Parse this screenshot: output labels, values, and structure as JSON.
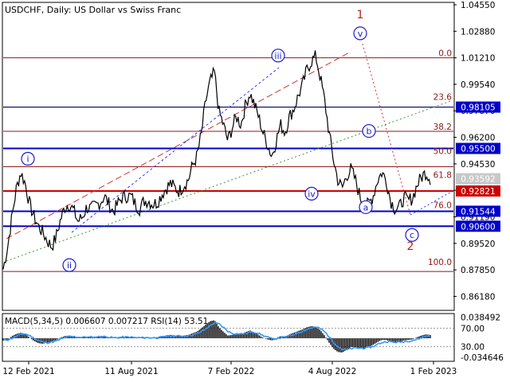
{
  "header": {
    "title": "USDCHF, Daily:  US Dollar vs Swiss Franc"
  },
  "colors": {
    "background": "#ffffff",
    "price": "#000000",
    "fib_line": "#8b1a1a",
    "support_line": "#0000cc",
    "red_line": "#cc0000",
    "wave_blue": "#1a1acc",
    "wave_red": "#b22222",
    "trend_red": "#cc3333",
    "trend_blue": "#3333ff",
    "trend_green": "#339933",
    "macd_hist": "#000000",
    "macd_signal": "#3399ff",
    "grid_dot": "#999999",
    "tag_blue": "#0000cc",
    "tag_red": "#cc0000",
    "tag_gray": "#c8c8c8"
  },
  "chart_data": [
    {
      "type": "line",
      "title": "USDCHF, Daily:  US Dollar vs Swiss Franc",
      "x_ticks": [
        "12 Feb 2021",
        "11 Aug 2021",
        "7 Feb 2022",
        "4 Aug 2022",
        "1 Feb 2023"
      ],
      "y_ticks": [
        "1.04550",
        "1.02880",
        "1.01210",
        "0.99540",
        "0.97870",
        "0.96200",
        "0.94530",
        "0.92860",
        "0.91190",
        "0.89520",
        "0.87850",
        "0.86180"
      ],
      "ylim": [
        0.8535,
        1.0465
      ],
      "series": [
        {
          "values": [
            0.879,
            0.893,
            0.912,
            0.93,
            0.94,
            0.933,
            0.92,
            0.912,
            0.906,
            0.902,
            0.897,
            0.893,
            0.899,
            0.91,
            0.918,
            0.92,
            0.916,
            0.909,
            0.912,
            0.918,
            0.917,
            0.919,
            0.921,
            0.925,
            0.92,
            0.915,
            0.92,
            0.924,
            0.925,
            0.925,
            0.92,
            0.917,
            0.922,
            0.922,
            0.92,
            0.921,
            0.926,
            0.93,
            0.933,
            0.93,
            0.928,
            0.932,
            0.935,
            0.944,
            0.95,
            0.964,
            0.985,
            0.997,
            1.003,
            0.978,
            0.97,
            0.96,
            0.968,
            0.975,
            0.97,
            0.982,
            0.99,
            0.983,
            0.975,
            0.965,
            0.958,
            0.95,
            0.96,
            0.97,
            0.965,
            0.975,
            0.98,
            0.988,
            0.995,
            1.005,
            1.01,
            1.013,
            1.0,
            0.985,
            0.965,
            0.948,
            0.935,
            0.93,
            0.938,
            0.942,
            0.935,
            0.925,
            0.918,
            0.92,
            0.925,
            0.935,
            0.94,
            0.935,
            0.922,
            0.917,
            0.918,
            0.924,
            0.922,
            0.924,
            0.932,
            0.937,
            0.94,
            0.936
          ]
        }
      ],
      "price_tags": [
        {
          "label": "0.98105",
          "value": 0.98105,
          "style": "blue"
        },
        {
          "label": "0.95500",
          "value": 0.955,
          "style": "blue"
        },
        {
          "label": "0.93592",
          "value": 0.93592,
          "style": "gray"
        },
        {
          "label": "0.92821",
          "value": 0.92821,
          "style": "red"
        },
        {
          "label": "0.91544",
          "value": 0.91544,
          "style": "blue"
        },
        {
          "label": "0.90600",
          "value": 0.906,
          "style": "blue"
        }
      ],
      "horizontal_lines": [
        {
          "value": 1.0121,
          "style": "fib"
        },
        {
          "value": 0.98105,
          "style": "blue_thin"
        },
        {
          "value": 0.9658,
          "style": "fib"
        },
        {
          "value": 0.955,
          "style": "blue"
        },
        {
          "value": 0.9435,
          "style": "fib"
        },
        {
          "value": 0.92821,
          "style": "red"
        },
        {
          "value": 0.91544,
          "style": "blue"
        },
        {
          "value": 0.906,
          "style": "blue"
        },
        {
          "value": 0.8775,
          "style": "fib"
        }
      ],
      "fib_labels": [
        {
          "label": "0.0",
          "value": 1.0121
        },
        {
          "label": "23.6",
          "value": 0.9845
        },
        {
          "label": "38.2",
          "value": 0.9658
        },
        {
          "label": "50.0",
          "value": 0.9505
        },
        {
          "label": "61.8",
          "value": 0.9355
        },
        {
          "label": "76.0",
          "value": 0.9165
        },
        {
          "label": "100.0",
          "value": 0.8805
        }
      ],
      "wave_labels": [
        {
          "label": "i",
          "value": 0.9485,
          "style": "blue_circle"
        },
        {
          "label": "ii",
          "value": 0.8815,
          "style": "blue_circle"
        },
        {
          "label": "iii",
          "value": 1.0135,
          "style": "blue_circle"
        },
        {
          "label": "iv",
          "value": 0.9265,
          "style": "blue_circle"
        },
        {
          "label": "v",
          "value": 1.0275,
          "style": "blue_circle"
        },
        {
          "label": "1",
          "value": 1.0395,
          "style": "red_text"
        },
        {
          "label": "a",
          "value": 0.918,
          "style": "blue_circle"
        },
        {
          "label": "b",
          "value": 0.966,
          "style": "blue_circle"
        },
        {
          "label": "c",
          "value": 0.9005,
          "style": "blue_circle"
        },
        {
          "label": "2",
          "value": 0.8935,
          "style": "red_text"
        }
      ]
    },
    {
      "type": "area",
      "title": "MACD(5,34,5) 0.006607 0.007217 RSI(14) 53.51",
      "y_ticks": [
        "0.038492",
        "70.00",
        "30.00",
        "-0.034646"
      ],
      "ylim": [
        -0.0405,
        0.0435
      ],
      "rsi_levels": [
        70,
        30
      ],
      "macd": [
        -0.004,
        -0.003,
        0.004,
        0.008,
        0.01,
        0.008,
        0.001,
        -0.005,
        -0.009,
        -0.01,
        -0.008,
        -0.006,
        -0.003,
        0.001,
        0.004,
        0.005,
        0.003,
        0.001,
        0.002,
        0.003,
        0.002,
        0.003,
        0.004,
        0.004,
        0.002,
        0.0,
        0.002,
        0.003,
        0.003,
        0.002,
        0.001,
        0.0,
        0.002,
        0.002,
        0.001,
        0.002,
        0.003,
        0.005,
        0.006,
        0.005,
        0.004,
        0.005,
        0.006,
        0.009,
        0.012,
        0.018,
        0.025,
        0.031,
        0.033,
        0.02,
        0.012,
        0.005,
        0.006,
        0.009,
        0.007,
        0.011,
        0.014,
        0.011,
        0.006,
        0.001,
        -0.002,
        -0.004,
        0.0,
        0.004,
        0.003,
        0.007,
        0.01,
        0.013,
        0.016,
        0.02,
        0.022,
        0.021,
        0.015,
        0.005,
        -0.008,
        -0.019,
        -0.025,
        -0.026,
        -0.021,
        -0.016,
        -0.016,
        -0.018,
        -0.019,
        -0.016,
        -0.012,
        -0.007,
        -0.003,
        -0.003,
        -0.007,
        -0.009,
        -0.007,
        -0.004,
        -0.003,
        -0.002,
        0.002,
        0.005,
        0.007,
        0.006
      ],
      "signal": [
        -0.002,
        -0.003,
        0.0,
        0.004,
        0.007,
        0.008,
        0.005,
        0.0,
        -0.004,
        -0.007,
        -0.008,
        -0.007,
        -0.005,
        -0.002,
        0.001,
        0.003,
        0.003,
        0.002,
        0.002,
        0.002,
        0.002,
        0.002,
        0.003,
        0.003,
        0.002,
        0.001,
        0.001,
        0.002,
        0.002,
        0.002,
        0.001,
        0.001,
        0.001,
        0.001,
        0.001,
        0.001,
        0.002,
        0.003,
        0.004,
        0.004,
        0.004,
        0.004,
        0.005,
        0.006,
        0.008,
        0.012,
        0.017,
        0.023,
        0.028,
        0.026,
        0.02,
        0.013,
        0.009,
        0.008,
        0.008,
        0.009,
        0.011,
        0.011,
        0.009,
        0.005,
        0.002,
        -0.001,
        -0.001,
        0.001,
        0.002,
        0.004,
        0.007,
        0.01,
        0.013,
        0.016,
        0.019,
        0.02,
        0.018,
        0.012,
        0.003,
        -0.007,
        -0.015,
        -0.02,
        -0.021,
        -0.019,
        -0.018,
        -0.018,
        -0.018,
        -0.017,
        -0.015,
        -0.011,
        -0.008,
        -0.006,
        -0.006,
        -0.007,
        -0.007,
        -0.006,
        -0.005,
        -0.004,
        -0.002,
        0.001,
        0.004,
        0.005
      ]
    }
  ]
}
